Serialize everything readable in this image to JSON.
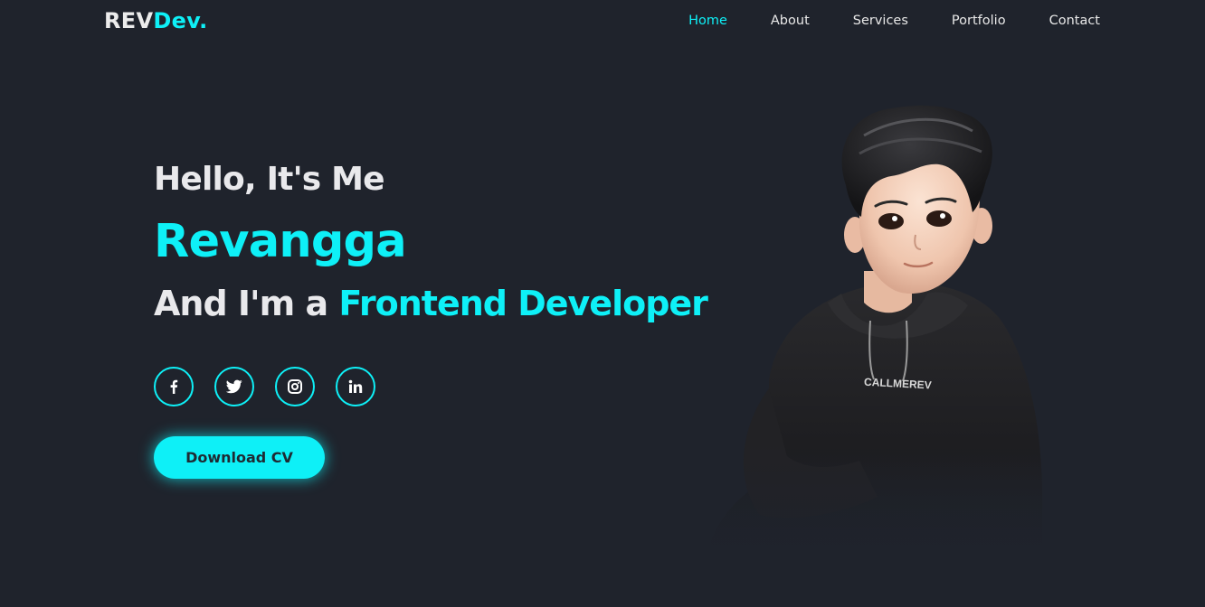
{
  "header": {
    "logo_main": "REV",
    "logo_accent": "Dev.",
    "nav": [
      "Home",
      "About",
      "Services",
      "Portfolio",
      "Contact"
    ],
    "active_nav": "Home"
  },
  "hero": {
    "greeting": "Hello, It's Me",
    "name": "Revangga",
    "role_prefix": "And I'm a",
    "role_highlight": "Frontend Developer",
    "download_label": "Download CV",
    "hoodie_text": "CALLMEREV"
  },
  "socials": [
    {
      "name": "facebook",
      "icon": "facebook-icon"
    },
    {
      "name": "twitter",
      "icon": "twitter-icon"
    },
    {
      "name": "instagram",
      "icon": "instagram-icon"
    },
    {
      "name": "linkedin",
      "icon": "linkedin-icon"
    }
  ],
  "colors": {
    "background": "#1f232c",
    "accent": "#0ef0f7",
    "text": "#e9e9ec"
  }
}
